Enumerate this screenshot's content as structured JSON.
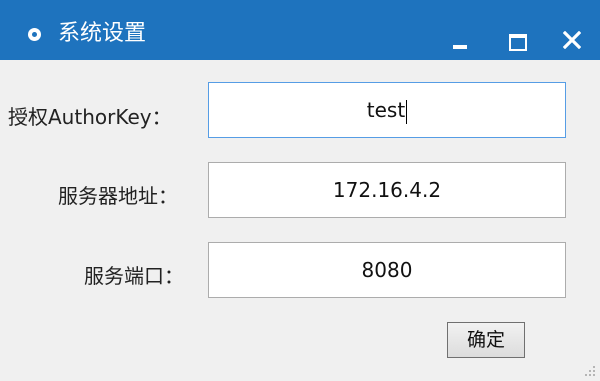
{
  "window": {
    "title": "系统设置",
    "titlebar_color": "#1e73be",
    "icons": [
      "app-icon",
      "minimize-icon",
      "maximize-icon",
      "close-icon"
    ]
  },
  "form": {
    "author_key": {
      "label": "授权AuthorKey：",
      "value": "test"
    },
    "server_address": {
      "label": "服务器地址：",
      "value": "172.16.4.2"
    },
    "server_port": {
      "label": "服务端口：",
      "value": "8080"
    }
  },
  "actions": {
    "ok_label": "确定"
  }
}
